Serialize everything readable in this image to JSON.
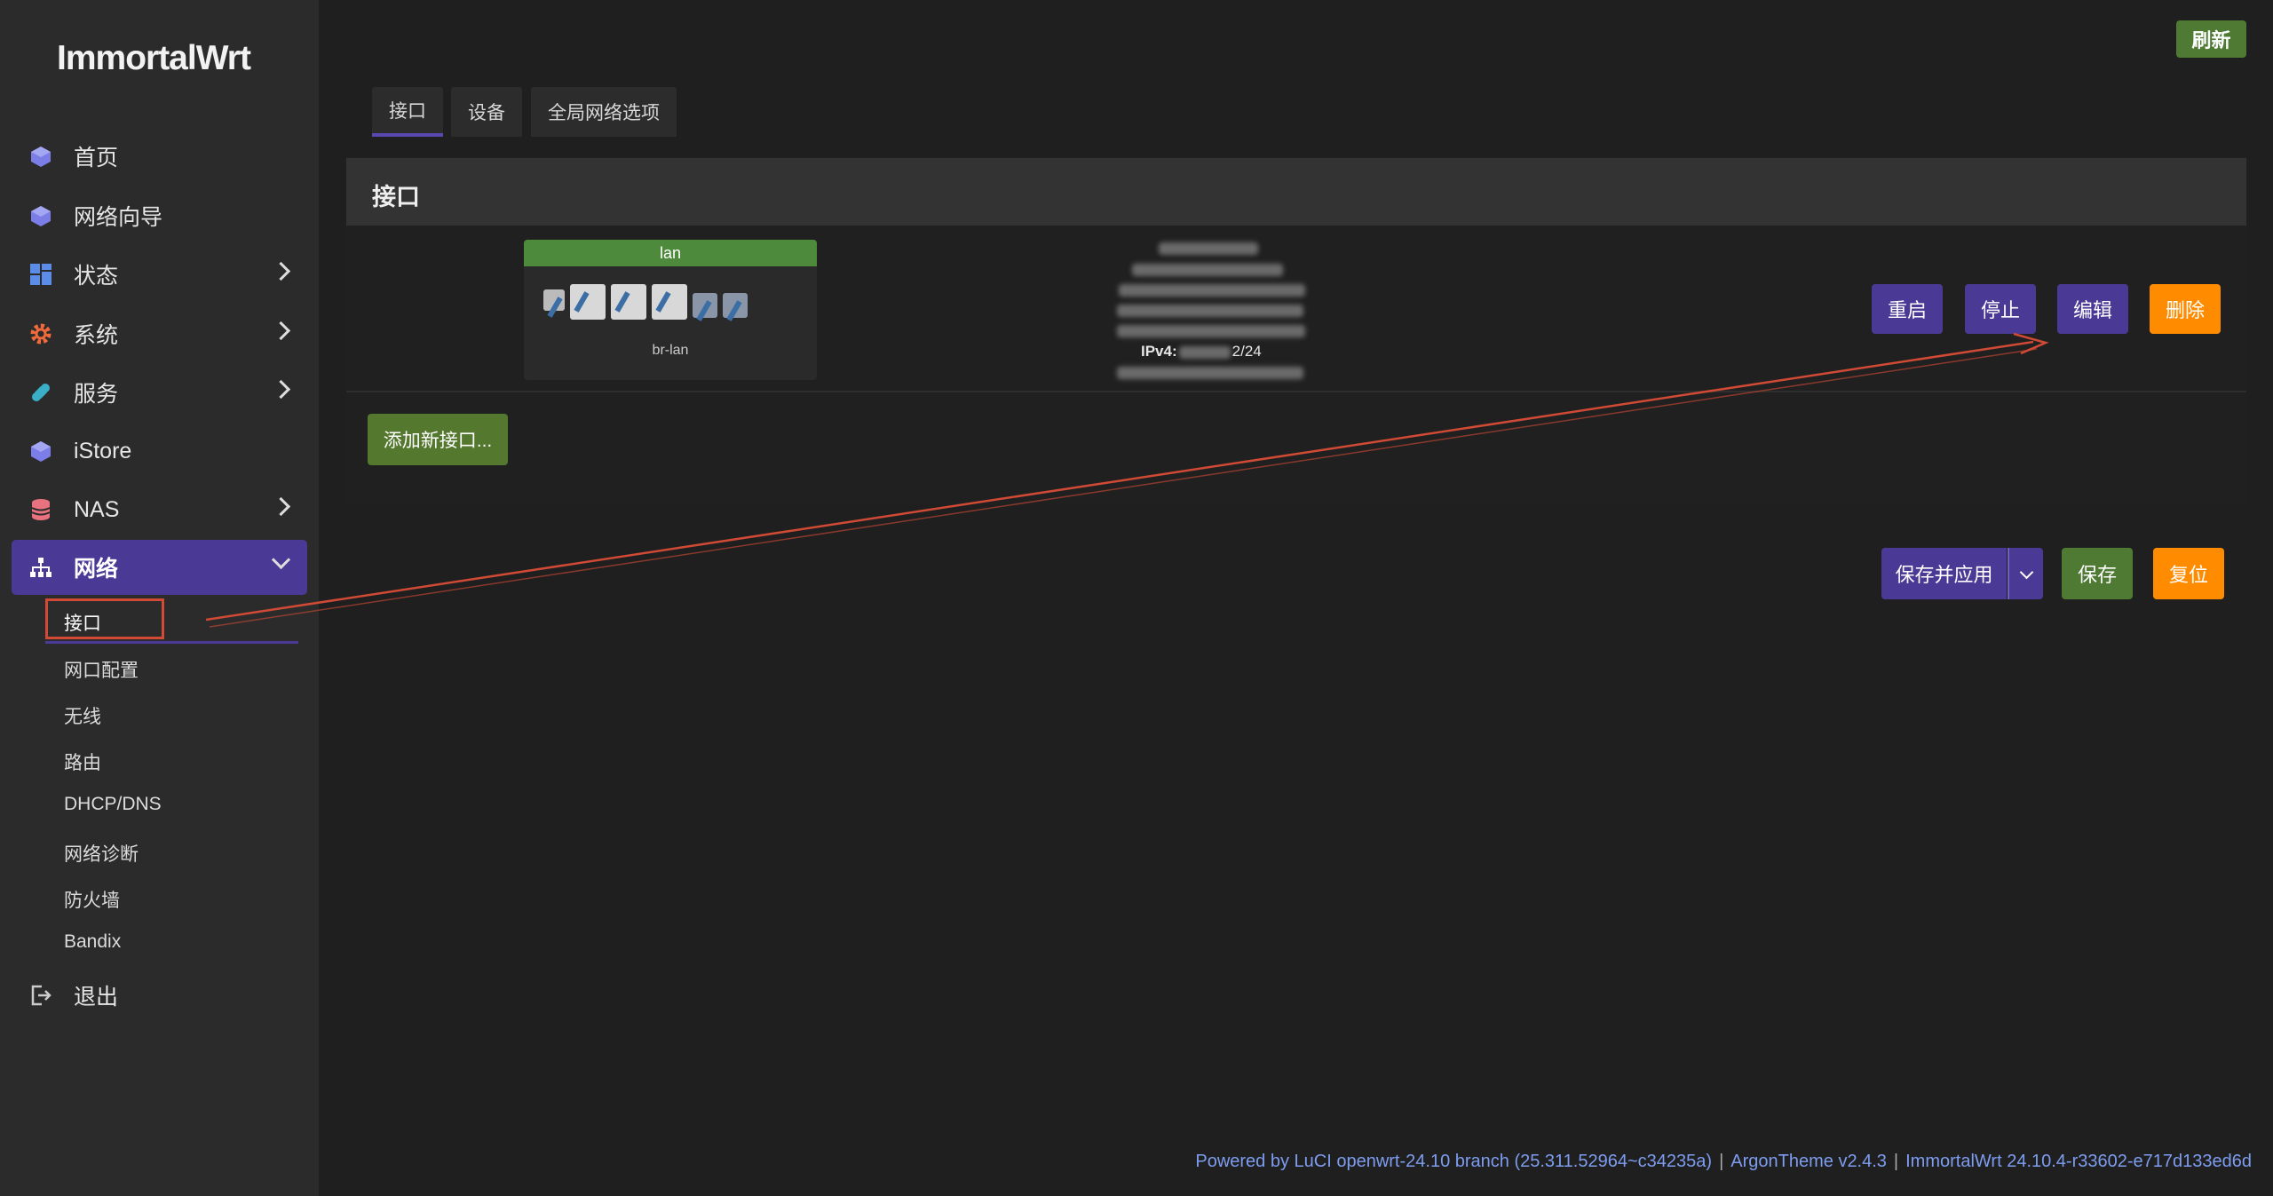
{
  "brand": "ImmortalWrt",
  "header": {
    "refresh_label": "刷新"
  },
  "sidebar": {
    "items": [
      {
        "label": "首页",
        "icon": "cube-icon"
      },
      {
        "label": "网络向导",
        "icon": "cube-icon"
      },
      {
        "label": "状态",
        "icon": "dashboard-icon",
        "expandable": true
      },
      {
        "label": "系统",
        "icon": "gear-icon",
        "expandable": true
      },
      {
        "label": "服务",
        "icon": "puzzle-icon",
        "expandable": true
      },
      {
        "label": "iStore",
        "icon": "cube-icon"
      },
      {
        "label": "NAS",
        "icon": "database-icon",
        "expandable": true
      },
      {
        "label": "网络",
        "icon": "sitemap-icon",
        "expandable": true,
        "active": true
      },
      {
        "label": "退出",
        "icon": "logout-icon"
      }
    ],
    "network_sub": [
      "接口",
      "网口配置",
      "无线",
      "路由",
      "DHCP/DNS",
      "网络诊断",
      "防火墙",
      "Bandix"
    ]
  },
  "tabs": [
    "接口",
    "设备",
    "全局网络选项"
  ],
  "panel": {
    "title": "接口",
    "interface": {
      "name": "lan",
      "device": "br-lan",
      "ipv4_label": "IPv4:",
      "ipv4_suffix": "2/24"
    },
    "actions": {
      "restart": "重启",
      "stop": "停止",
      "edit": "编辑",
      "delete": "删除"
    },
    "add_label": "添加新接口..."
  },
  "bottom_actions": {
    "save_apply": "保存并应用",
    "save": "保存",
    "reset": "复位"
  },
  "footer": {
    "luci": "Powered by LuCI openwrt-24.10 branch (25.311.52964~c34235a)",
    "theme": "ArgonTheme v2.4.3",
    "version": "ImmortalWrt 24.10.4-r33602-e717d133ed6d"
  },
  "colors": {
    "accent": "#4a3a96",
    "green": "#4e7a34",
    "orange": "#ff8c00",
    "annotation": "#d04a35"
  }
}
